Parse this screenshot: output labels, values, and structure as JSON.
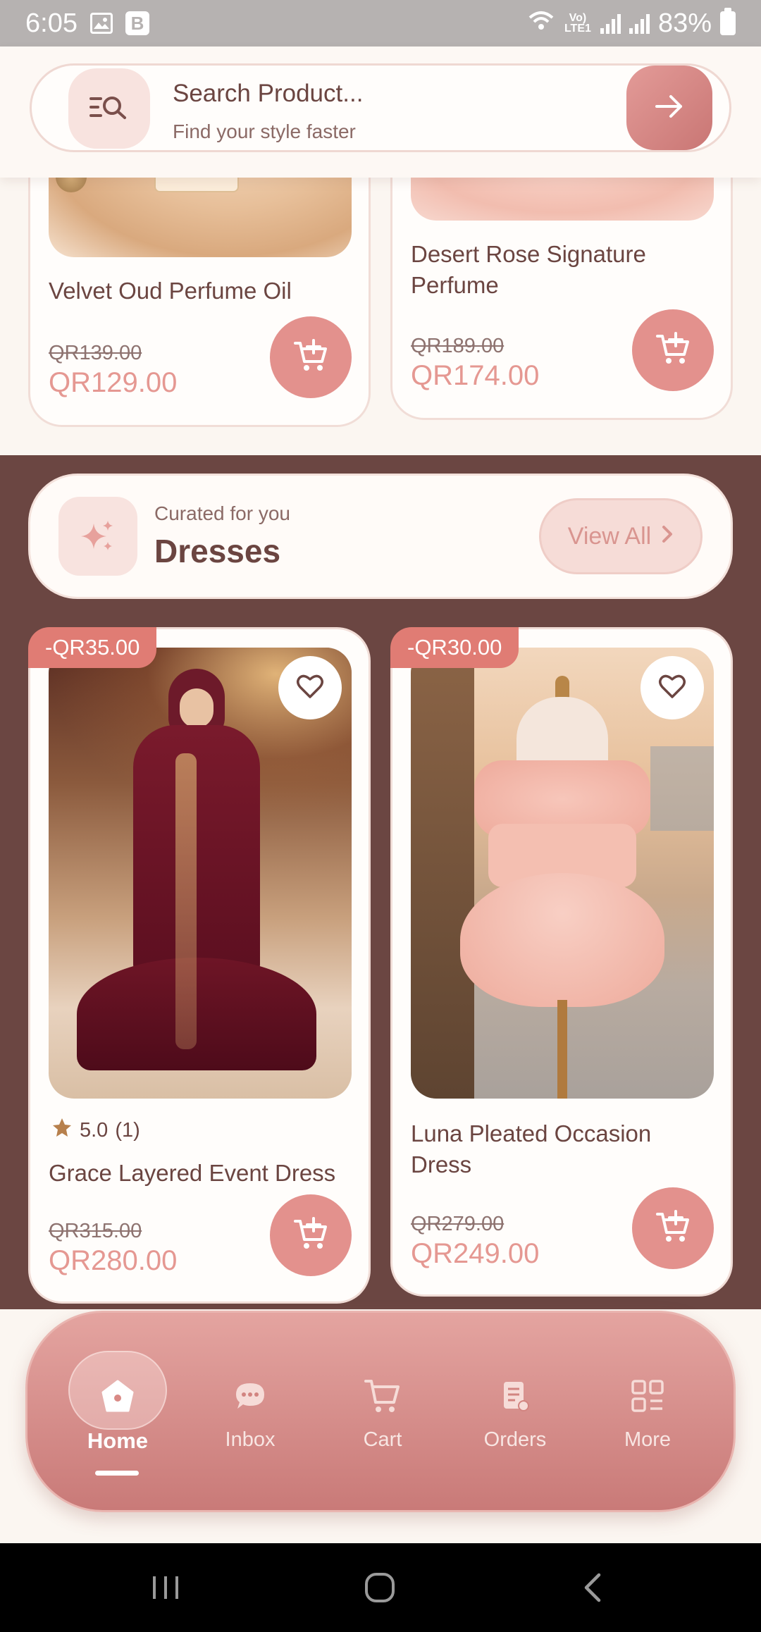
{
  "status_bar": {
    "time": "6:05",
    "battery": "83%",
    "network": "Vo) LTE1"
  },
  "search": {
    "title": "Search Product...",
    "subtitle": "Find your style faster"
  },
  "top_products": [
    {
      "name": "Velvet Oud Perfume Oil",
      "old_price": "QR139.00",
      "price": "QR129.00"
    },
    {
      "name": "Desert Rose Signature Perfume",
      "old_price": "QR189.00",
      "price": "QR174.00"
    }
  ],
  "section": {
    "kicker": "Curated for you",
    "title": "Dresses",
    "view_all": "View All"
  },
  "dresses": [
    {
      "badge": "-QR35.00",
      "rating": "5.0",
      "rating_count": "(1)",
      "name": "Grace Layered Event Dress",
      "old_price": "QR315.00",
      "price": "QR280.00"
    },
    {
      "badge": "-QR30.00",
      "name": "Luna Pleated Occasion Dress",
      "old_price": "QR279.00",
      "price": "QR249.00"
    }
  ],
  "nav": {
    "items": [
      {
        "label": "Home",
        "icon": "home-icon",
        "active": true
      },
      {
        "label": "Inbox",
        "icon": "chat-icon"
      },
      {
        "label": "Cart",
        "icon": "cart-icon"
      },
      {
        "label": "Orders",
        "icon": "orders-icon"
      },
      {
        "label": "More",
        "icon": "grid-icon"
      }
    ]
  },
  "colors": {
    "accent": "#e3918d",
    "section_bg": "#6b4642",
    "text": "#6b4541",
    "badge": "#e07c74"
  }
}
